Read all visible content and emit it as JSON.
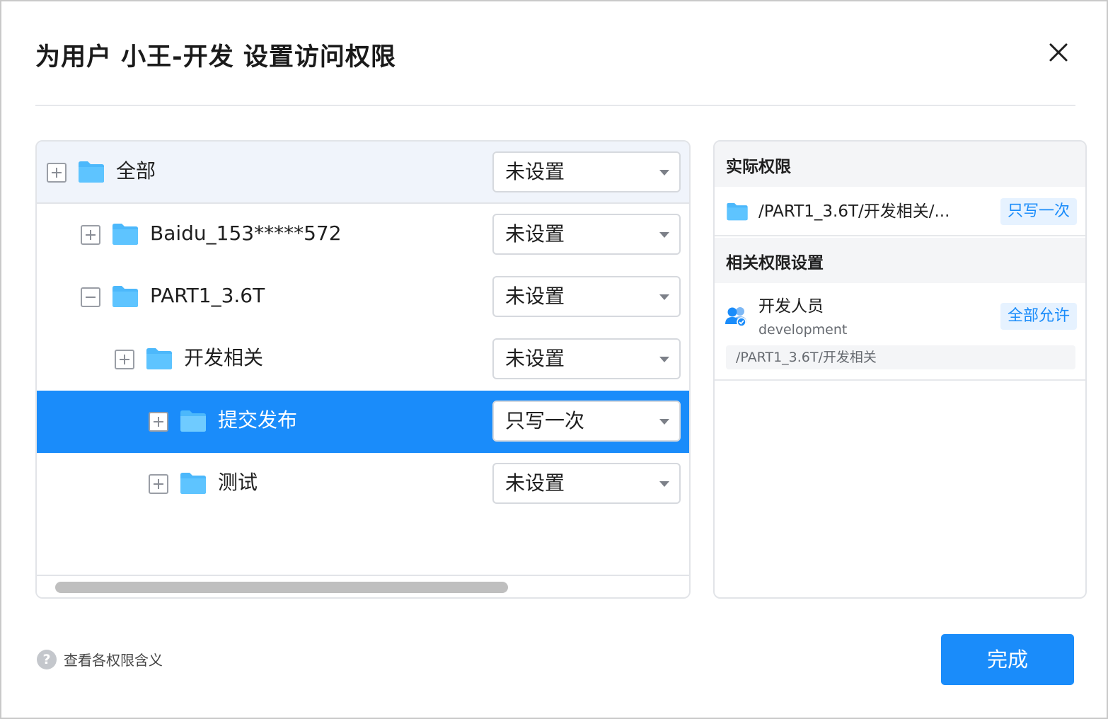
{
  "dialog": {
    "title": "为用户 小王-开发 设置访问权限"
  },
  "tree": {
    "rows": [
      {
        "label": "全部",
        "expander": "plus",
        "permission": "未设置"
      },
      {
        "label": "Baidu_153*****572",
        "expander": "plus",
        "permission": "未设置"
      },
      {
        "label": "PART1_3.6T",
        "expander": "minus",
        "permission": "未设置"
      },
      {
        "label": "开发相关",
        "expander": "plus",
        "permission": "未设置"
      },
      {
        "label": "提交发布",
        "expander": "plus",
        "permission": "只写一次",
        "selected": true
      },
      {
        "label": "测试",
        "expander": "plus",
        "permission": "未设置"
      }
    ]
  },
  "side": {
    "actual_title": "实际权限",
    "actual_path": "/PART1_3.6T/开发相关/...",
    "actual_tag": "只写一次",
    "related_title": "相关权限设置",
    "related": {
      "name": "开发人员",
      "sub": "development",
      "tag": "全部允许",
      "path": "/PART1_3.6T/开发相关"
    }
  },
  "footer": {
    "help_icon": "?",
    "help_text": "查看各权限含义",
    "done_label": "完成"
  },
  "colors": {
    "accent": "#1a8cfa",
    "folder": "#4cb8fb",
    "selected_row": "#1a8cfa"
  }
}
